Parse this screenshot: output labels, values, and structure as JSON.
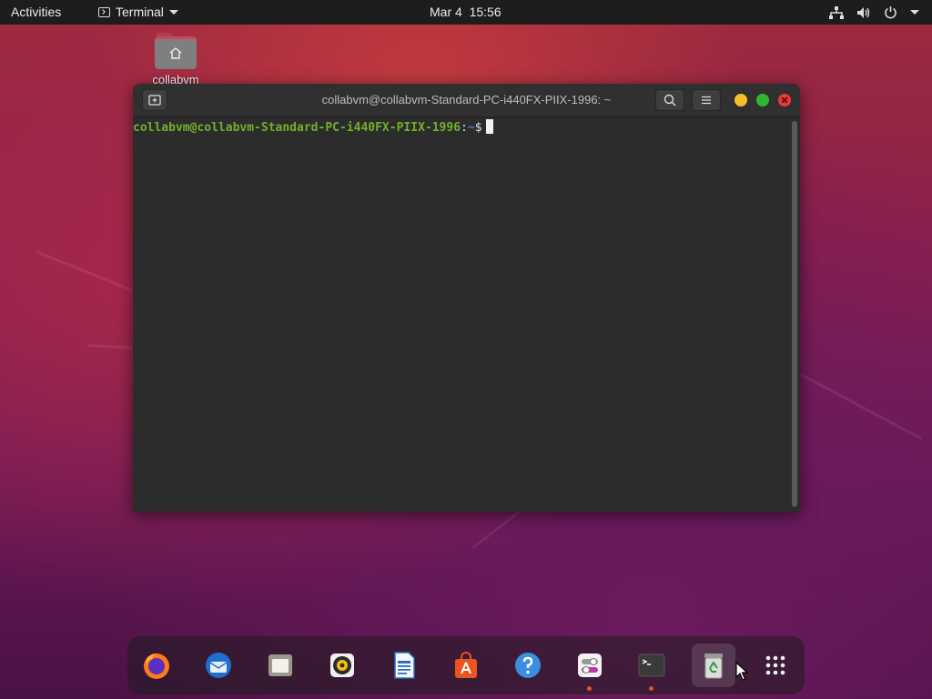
{
  "topbar": {
    "activities": "Activities",
    "app_menu_label": "Terminal",
    "clock": "Mar 4  15:56",
    "tray_icons": [
      "network-icon",
      "volume-icon",
      "power-icon",
      "chevron-down-icon"
    ]
  },
  "desktop": {
    "icons": [
      {
        "label": "collabvm",
        "icon": "home-folder-icon"
      }
    ]
  },
  "terminal": {
    "title": "collabvm@collabvm-Standard-PC-i440FX-PIIX-1996: ~",
    "prompt": {
      "user_host": "collabvm@collabvm-Standard-PC-i440FX-PIIX-1996",
      "separator": ":",
      "path": "~",
      "symbol": "$"
    }
  },
  "dock": {
    "apps": [
      {
        "name": "Firefox",
        "icon": "firefox-icon",
        "running": false
      },
      {
        "name": "Thunderbird",
        "icon": "thunderbird-icon",
        "running": false
      },
      {
        "name": "Files",
        "icon": "files-icon",
        "running": false
      },
      {
        "name": "Rhythmbox",
        "icon": "rhythmbox-icon",
        "running": false
      },
      {
        "name": "LibreOffice Writer",
        "icon": "writer-icon",
        "running": false
      },
      {
        "name": "Ubuntu Software",
        "icon": "software-icon",
        "running": false
      },
      {
        "name": "Help",
        "icon": "help-icon",
        "running": false
      },
      {
        "name": "Settings",
        "icon": "settings-icon",
        "running": true
      },
      {
        "name": "Terminal",
        "icon": "terminal-icon",
        "running": true
      },
      {
        "name": "Trash",
        "icon": "trash-icon",
        "running": false
      },
      {
        "name": "Show Applications",
        "icon": "app-grid-icon",
        "running": false
      }
    ]
  },
  "colors": {
    "topbar_bg": "#1d1d1d",
    "terminal_bg": "#2c2c2c",
    "prompt_user": "#73b02a",
    "prompt_path": "#4e7ec7",
    "running_dot": "#e95420"
  }
}
